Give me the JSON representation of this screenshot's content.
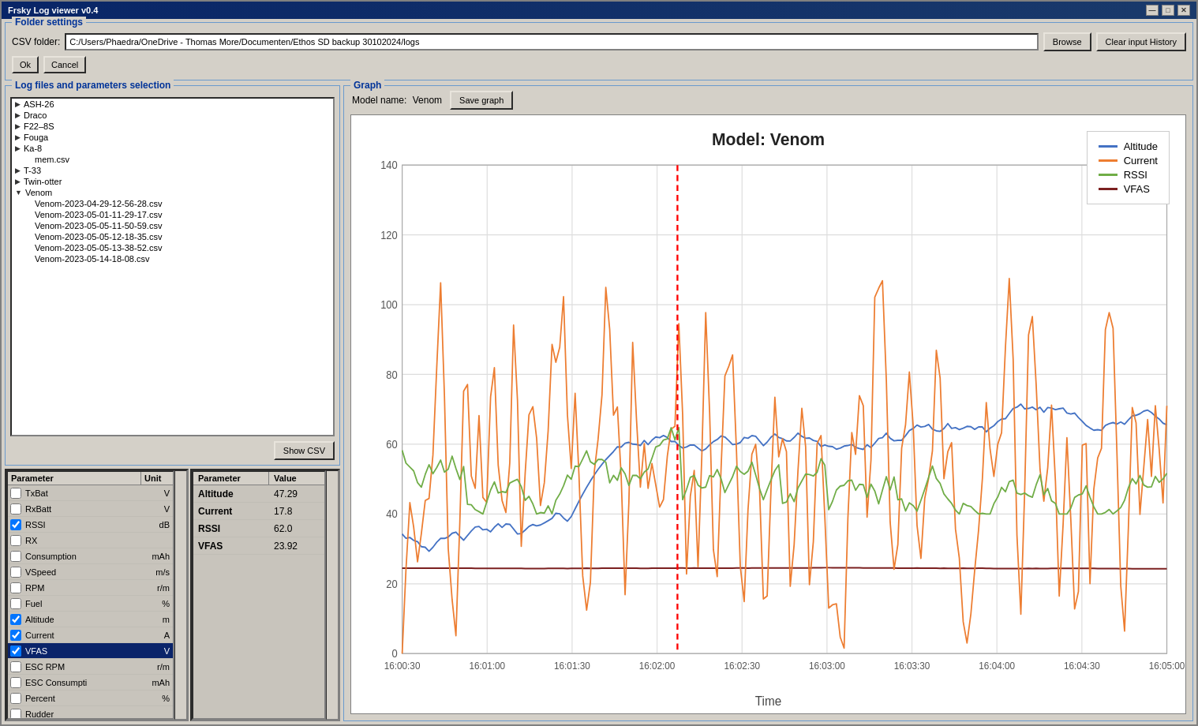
{
  "window": {
    "title": "Frsky Log viewer v0.4",
    "controls": [
      "—",
      "□",
      "✕"
    ]
  },
  "folder_settings": {
    "section_label": "Folder settings",
    "csv_label": "CSV folder:",
    "csv_path": "C:/Users/Phaedra/OneDrive - Thomas More/Documenten/Ethos SD backup 30102024/logs",
    "browse_label": "Browse",
    "clear_label": "Clear input History",
    "ok_label": "Ok",
    "cancel_label": "Cancel"
  },
  "log_files": {
    "section_label": "Log files and parameters selection",
    "show_csv_label": "Show CSV",
    "tree": [
      {
        "id": "ASH-26",
        "label": "ASH-26",
        "indent": 0,
        "expanded": false,
        "type": "folder"
      },
      {
        "id": "Draco",
        "label": "Draco",
        "indent": 0,
        "expanded": false,
        "type": "folder"
      },
      {
        "id": "F22-8S",
        "label": "F22–8S",
        "indent": 0,
        "expanded": false,
        "type": "folder"
      },
      {
        "id": "Fouga",
        "label": "Fouga",
        "indent": 0,
        "expanded": false,
        "type": "folder"
      },
      {
        "id": "Ka-8",
        "label": "Ka-8",
        "indent": 0,
        "expanded": false,
        "type": "folder"
      },
      {
        "id": "mem.csv",
        "label": "mem.csv",
        "indent": 1,
        "type": "file"
      },
      {
        "id": "T-33",
        "label": "T-33",
        "indent": 0,
        "expanded": false,
        "type": "folder"
      },
      {
        "id": "Twin-otter",
        "label": "Twin-otter",
        "indent": 0,
        "expanded": false,
        "type": "folder"
      },
      {
        "id": "Venom",
        "label": "Venom",
        "indent": 0,
        "expanded": true,
        "type": "folder"
      },
      {
        "id": "v1",
        "label": "Venom-2023-04-29-12-56-28.csv",
        "indent": 1,
        "type": "file"
      },
      {
        "id": "v2",
        "label": "Venom-2023-05-01-11-29-17.csv",
        "indent": 1,
        "type": "file"
      },
      {
        "id": "v3",
        "label": "Venom-2023-05-05-11-50-59.csv",
        "indent": 1,
        "type": "file"
      },
      {
        "id": "v4",
        "label": "Venom-2023-05-05-12-18-35.csv",
        "indent": 1,
        "type": "file"
      },
      {
        "id": "v5",
        "label": "Venom-2023-05-05-13-38-52.csv",
        "indent": 1,
        "type": "file"
      },
      {
        "id": "v6",
        "label": "Venom-2023-05-14-18-08.csv",
        "indent": 1,
        "type": "file"
      }
    ]
  },
  "parameters": {
    "header_param": "Parameter",
    "header_unit": "Unit",
    "items": [
      {
        "name": "TxBat",
        "unit": "V",
        "checked": false,
        "selected": false
      },
      {
        "name": "RxBatt",
        "unit": "V",
        "checked": false,
        "selected": false
      },
      {
        "name": "RSSI",
        "unit": "dB",
        "checked": true,
        "selected": false
      },
      {
        "name": "RX",
        "unit": "",
        "checked": false,
        "selected": false
      },
      {
        "name": "Consumption",
        "unit": "mAh",
        "checked": false,
        "selected": false
      },
      {
        "name": "VSpeed",
        "unit": "m/s",
        "checked": false,
        "selected": false
      },
      {
        "name": "RPM",
        "unit": "r/m",
        "checked": false,
        "selected": false
      },
      {
        "name": "Fuel",
        "unit": "%",
        "checked": false,
        "selected": false
      },
      {
        "name": "Altitude",
        "unit": "m",
        "checked": true,
        "selected": false
      },
      {
        "name": "Current",
        "unit": "A",
        "checked": true,
        "selected": false
      },
      {
        "name": "VFAS",
        "unit": "V",
        "checked": true,
        "selected": true
      },
      {
        "name": "ESC RPM",
        "unit": "r/m",
        "checked": false,
        "selected": false
      },
      {
        "name": "ESC Consumpti",
        "unit": "mAh",
        "checked": false,
        "selected": false
      },
      {
        "name": "Percent",
        "unit": "%",
        "checked": false,
        "selected": false
      },
      {
        "name": "Rudder",
        "unit": "",
        "checked": false,
        "selected": false
      }
    ]
  },
  "param_values": {
    "header_param": "Parameter",
    "header_value": "Value",
    "items": [
      {
        "name": "Altitude",
        "value": "47.29"
      },
      {
        "name": "Current",
        "value": "17.8"
      },
      {
        "name": "RSSI",
        "value": "62.0"
      },
      {
        "name": "VFAS",
        "value": "23.92"
      }
    ]
  },
  "graph": {
    "section_label": "Graph",
    "model_label": "Model name:",
    "model_name": "Venom",
    "save_label": "Save graph",
    "chart_title": "Model: Venom",
    "x_label": "Time",
    "y_axis": [
      0,
      20,
      40,
      60,
      80,
      100,
      120,
      140
    ],
    "x_ticks": [
      "16:00:30",
      "16:01:00",
      "16:01:30",
      "16:02:00",
      "16:02:30",
      "16:03:00",
      "16:03:30",
      "16:04:00",
      "16:04:30",
      "16:05:00"
    ],
    "legend": [
      {
        "label": "Altitude",
        "color": "#4472C4"
      },
      {
        "label": "Current",
        "color": "#ED7D31"
      },
      {
        "label": "RSSI",
        "color": "#70AD47"
      },
      {
        "label": "VFAS",
        "color": "#7B2020"
      }
    ],
    "cursor_x_pct": 36
  }
}
